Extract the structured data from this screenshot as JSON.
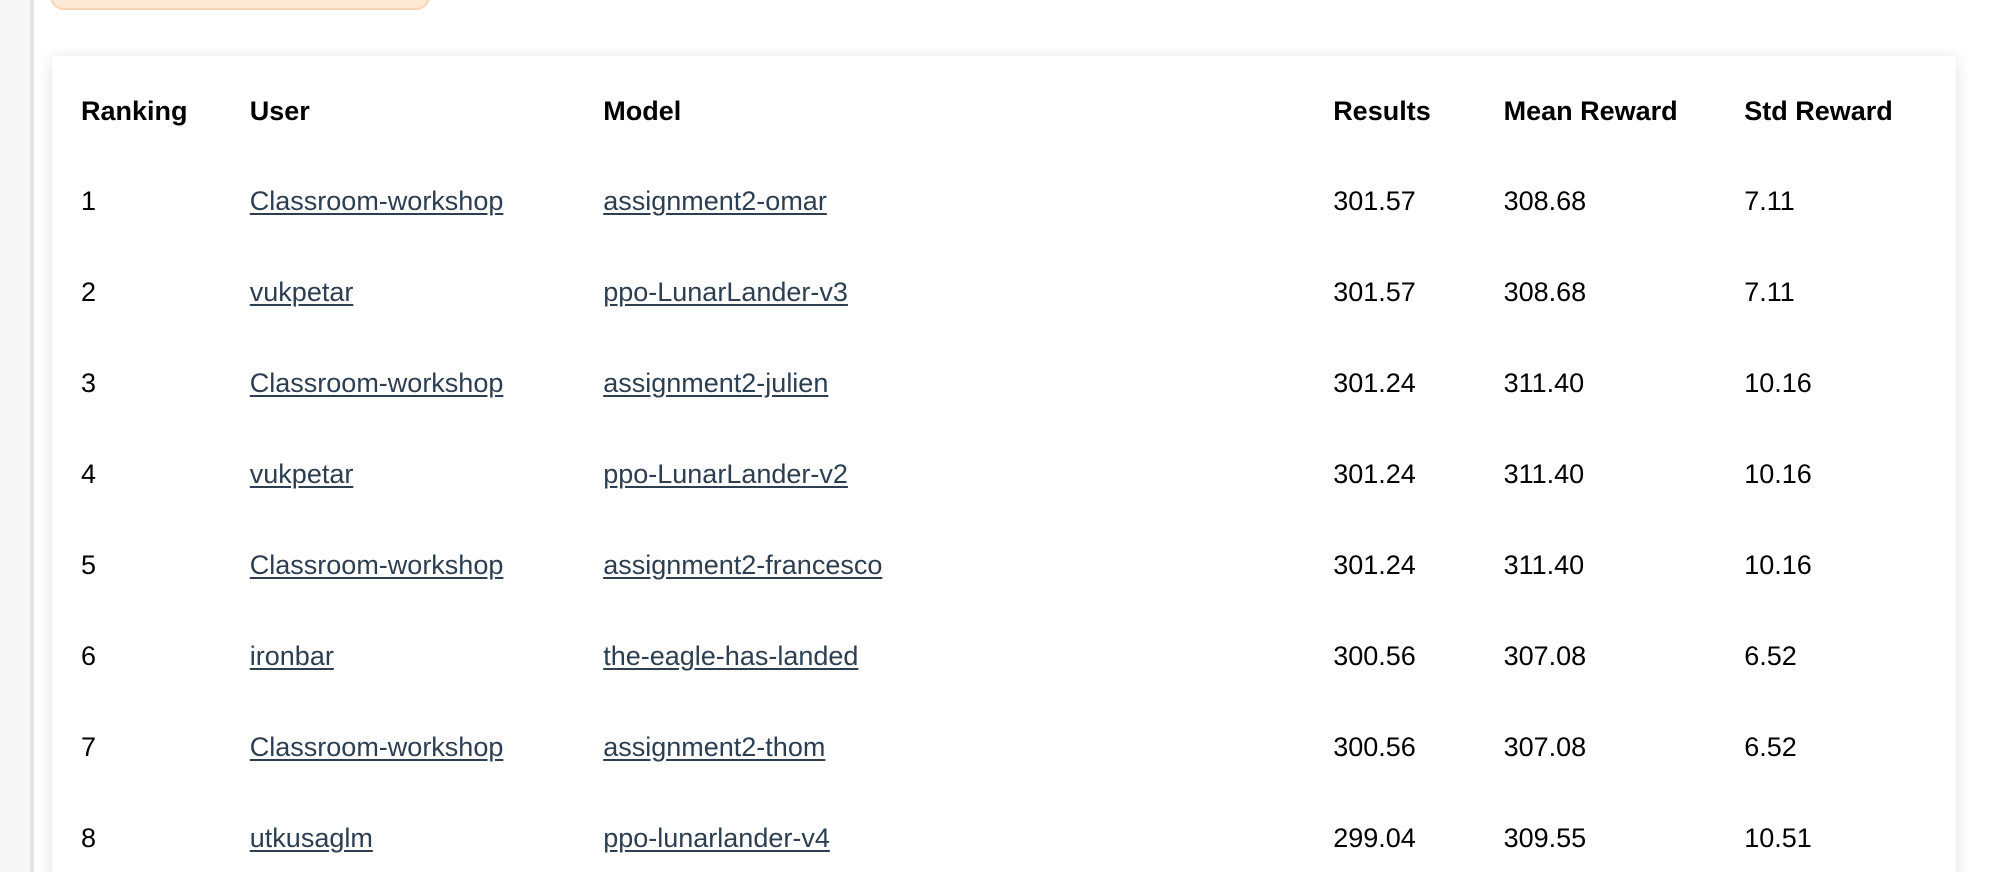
{
  "table": {
    "headers": {
      "ranking": "Ranking",
      "user": "User",
      "model": "Model",
      "results": "Results",
      "mean_reward": "Mean Reward",
      "std_reward": "Std Reward"
    },
    "rows": [
      {
        "ranking": "1",
        "user": "Classroom-workshop",
        "model": "assignment2-omar",
        "results": "301.57",
        "mean_reward": "308.68",
        "std_reward": "7.11"
      },
      {
        "ranking": "2",
        "user": "vukpetar",
        "model": "ppo-LunarLander-v3",
        "results": "301.57",
        "mean_reward": "308.68",
        "std_reward": "7.11"
      },
      {
        "ranking": "3",
        "user": "Classroom-workshop",
        "model": "assignment2-julien",
        "results": "301.24",
        "mean_reward": "311.40",
        "std_reward": "10.16"
      },
      {
        "ranking": "4",
        "user": "vukpetar",
        "model": "ppo-LunarLander-v2",
        "results": "301.24",
        "mean_reward": "311.40",
        "std_reward": "10.16"
      },
      {
        "ranking": "5",
        "user": "Classroom-workshop",
        "model": "assignment2-francesco",
        "results": "301.24",
        "mean_reward": "311.40",
        "std_reward": "10.16"
      },
      {
        "ranking": "6",
        "user": "ironbar",
        "model": "the-eagle-has-landed",
        "results": "300.56",
        "mean_reward": "307.08",
        "std_reward": "6.52"
      },
      {
        "ranking": "7",
        "user": "Classroom-workshop",
        "model": "assignment2-thom",
        "results": "300.56",
        "mean_reward": "307.08",
        "std_reward": "6.52"
      },
      {
        "ranking": "8",
        "user": "utkusaglm",
        "model": "ppo-lunarlander-v4",
        "results": "299.04",
        "mean_reward": "309.55",
        "std_reward": "10.51"
      }
    ]
  },
  "colors": {
    "link": "#2c3e50",
    "pill_fill": "#fde9d6",
    "pill_border": "#f9d4b2"
  }
}
